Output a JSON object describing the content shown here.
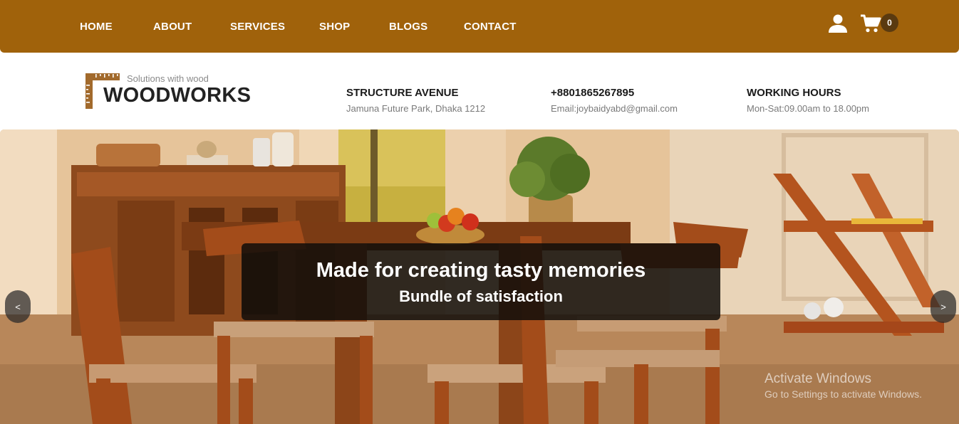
{
  "nav": {
    "items": [
      {
        "label": "HOME"
      },
      {
        "label": "ABOUT"
      },
      {
        "label": "SERVICES"
      },
      {
        "label": "SHOP"
      },
      {
        "label": "BLOGS"
      },
      {
        "label": "CONTACT"
      }
    ],
    "cart_count": "0",
    "user_icon": "user-icon",
    "cart_icon": "shopping-cart-icon",
    "background": "#a0620b"
  },
  "brand": {
    "tagline": "Solutions with wood",
    "name": "WOODWORKS",
    "logo_icon": "carpenter-square-icon"
  },
  "info": {
    "address": {
      "title": "STRUCTURE AVENUE",
      "text": "Jamuna Future Park, Dhaka 1212"
    },
    "phone": {
      "title": "+8801865267895",
      "text": "Email:joybaidyabd@gmail.com"
    },
    "hours": {
      "title": "WORKING HOURS",
      "text": "Mon-Sat:09.00am to 18.00pm"
    }
  },
  "hero": {
    "title": "Made for creating tasty memories",
    "subtitle": "Bundle of satisfaction",
    "prev_label": "<",
    "next_label": ">"
  },
  "watermark": {
    "title": "Activate Windows",
    "text": "Go to Settings to activate Windows."
  }
}
